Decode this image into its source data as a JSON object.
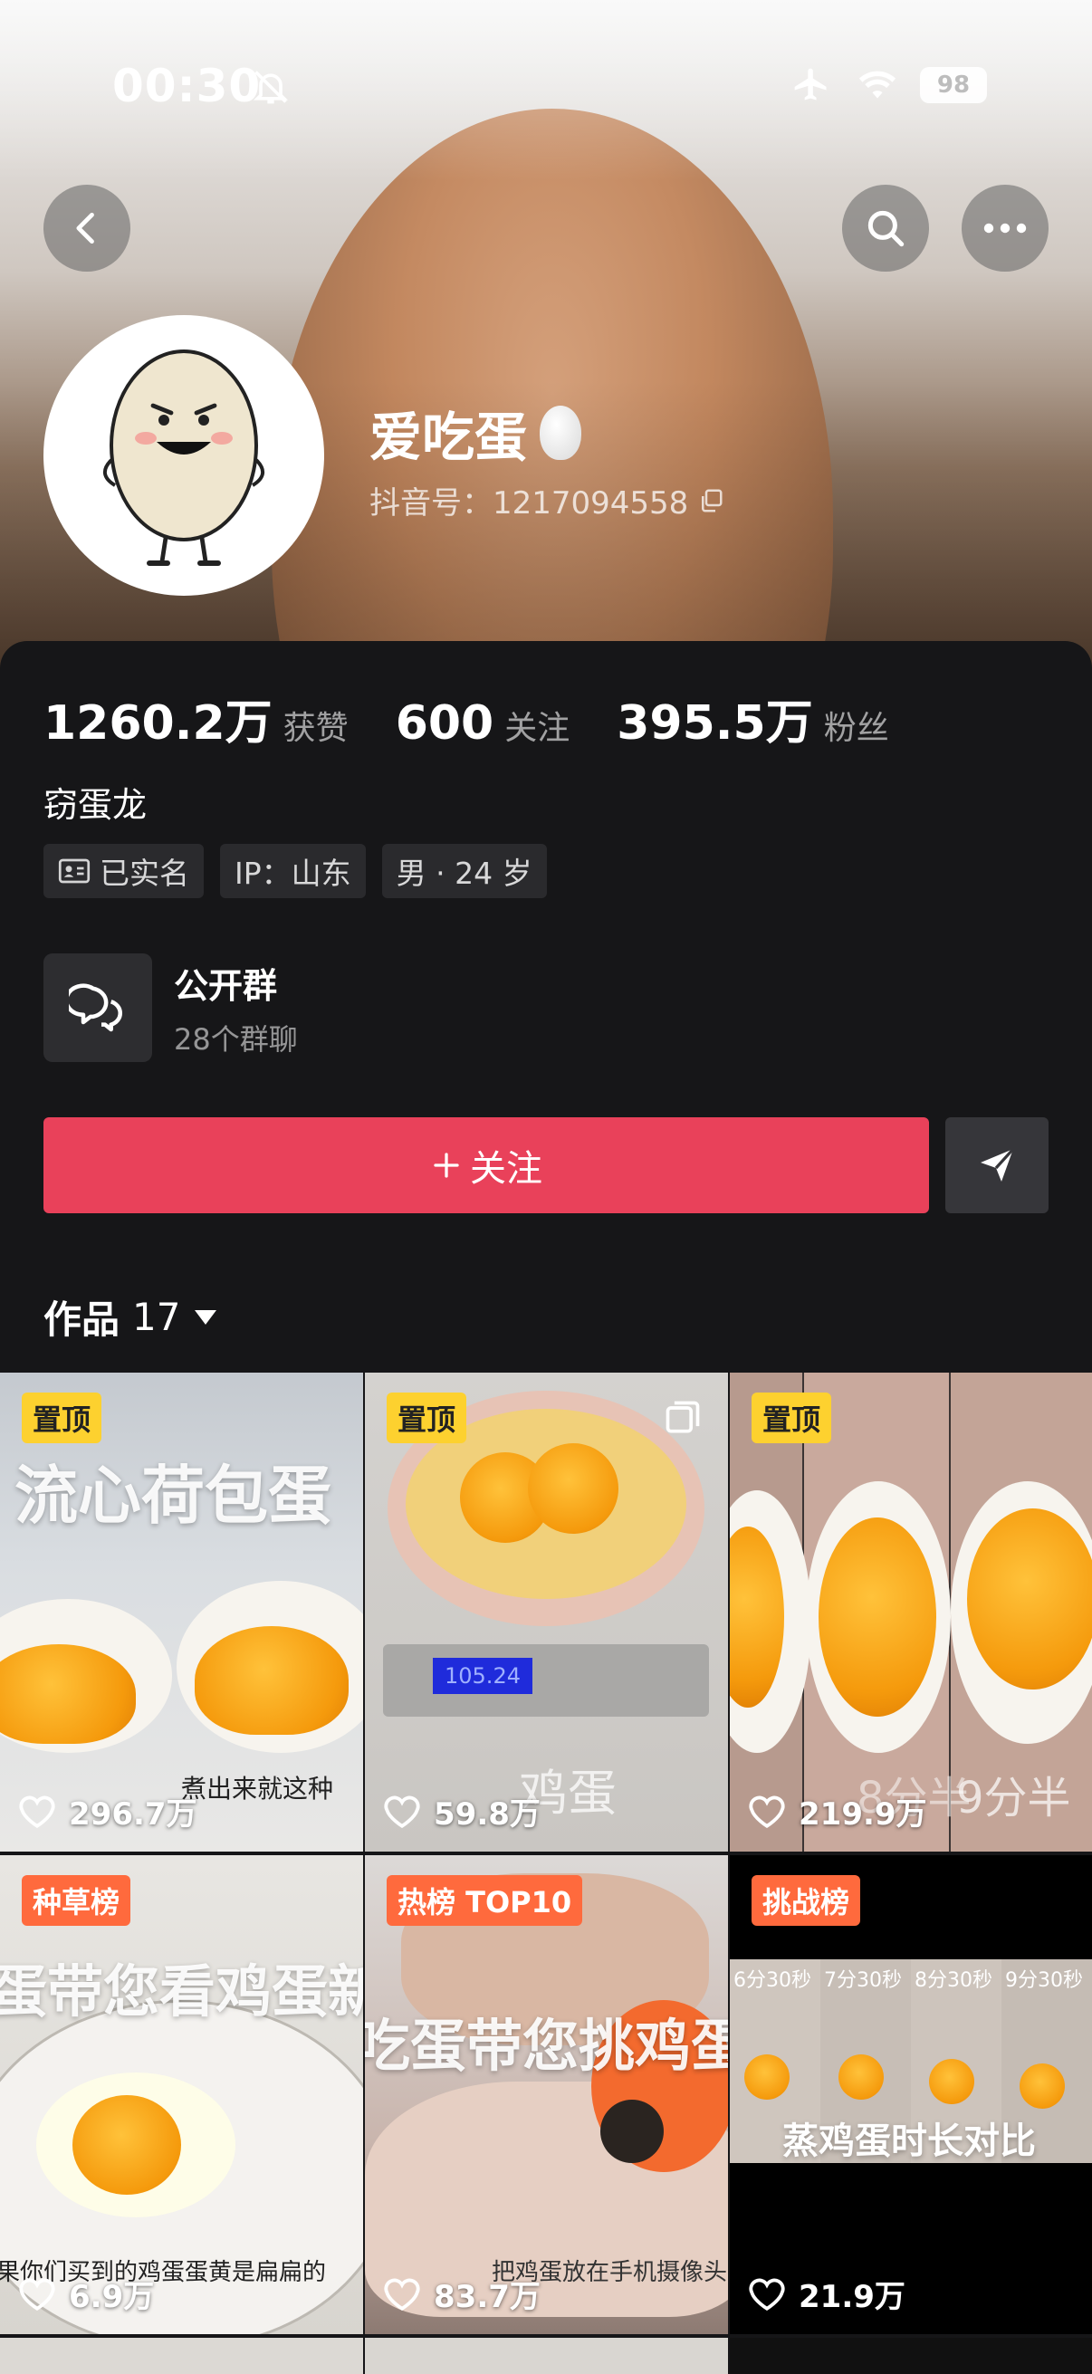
{
  "status_bar": {
    "time": "00:30",
    "battery": "98"
  },
  "profile": {
    "name": "爱吃蛋",
    "douyin_id": "抖音号：1217094558",
    "bio": "窃蛋龙",
    "stats": [
      {
        "value": "1260.2万",
        "label": "获赞"
      },
      {
        "value": "600",
        "label": "关注"
      },
      {
        "value": "395.5万",
        "label": "粉丝"
      }
    ],
    "tags": {
      "verified": "已实名",
      "ip": "IP：山东",
      "gender_age": "男 · 24 岁"
    }
  },
  "group": {
    "title": "公开群",
    "subtitle": "28个群聊"
  },
  "actions": {
    "follow_label": "关注"
  },
  "works_tab": {
    "label": "作品",
    "count": "17"
  },
  "videos": [
    {
      "badge": "置顶",
      "title": "流心荷包蛋",
      "caption": "煮出来就这种",
      "likes": "296.7万"
    },
    {
      "badge": "置顶",
      "caption": "鸡蛋",
      "scale": "105.24",
      "likes": "59.8万"
    },
    {
      "badge": "置顶",
      "caption": "9分半",
      "caption2": "8分半",
      "likes": "219.9万"
    },
    {
      "badge": "种草榜",
      "title": "蛋带您看鸡蛋新鲜",
      "caption": "果你们买到的鸡蛋蛋黄是扁扁的",
      "likes": "6.9万"
    },
    {
      "badge": "热榜 TOP10",
      "title": "吃蛋带您挑鸡蛋",
      "caption": "把鸡蛋放在手机摄像头",
      "likes": "83.7万"
    },
    {
      "badge": "挑战榜",
      "title": "蒸鸡蛋时长对比",
      "times": [
        "6分30秒",
        "7分30秒",
        "8分30秒",
        "9分30秒"
      ],
      "likes": "21.9万"
    }
  ],
  "colors": {
    "accent": "#e9415a",
    "pin_badge": "#fdd12f",
    "rank_badge": "#ff6a3d",
    "panel_bg": "#161618"
  }
}
